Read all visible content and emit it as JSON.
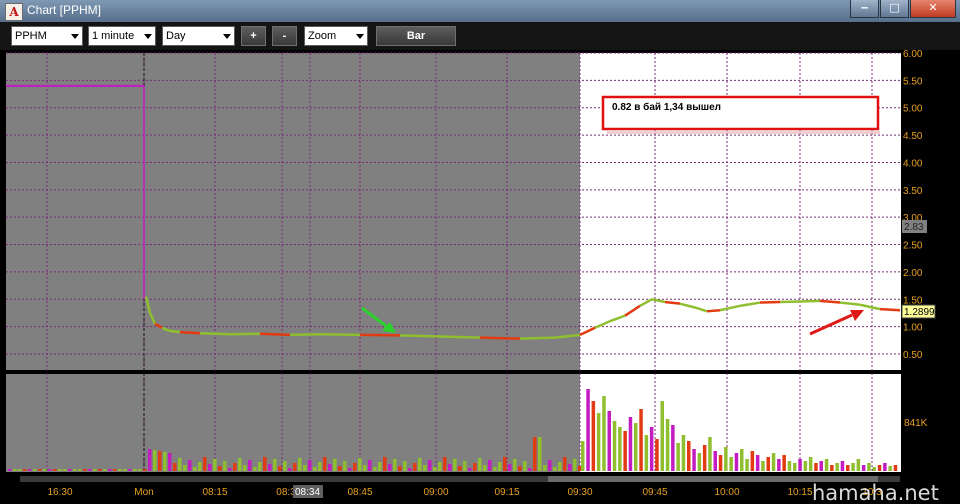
{
  "window": {
    "app_icon": "A",
    "title": "Chart [PPHM]",
    "min_glyph": "‒",
    "max_glyph": "□",
    "close_glyph": "✕"
  },
  "toolbar": {
    "symbol": "PPHM",
    "interval": "1 minute",
    "range": "Day",
    "zoom_in": "+",
    "zoom_out": "-",
    "zoom": "Zoom",
    "style": "Bar"
  },
  "annotation": {
    "text": "0.82 в бай 1,34 вышел"
  },
  "price_axis": {
    "ticks": [
      "6.00",
      "5.50",
      "5.00",
      "4.50",
      "4.00",
      "3.50",
      "3.00",
      "2.50",
      "2.00",
      "1.50",
      "1.00",
      "0.50"
    ],
    "current_price": "1.2899",
    "marker_price": "2.83"
  },
  "volume_axis": {
    "label": "841K"
  },
  "time_axis": {
    "ticks": [
      "16:30",
      "Mon",
      "08:15",
      "08:3",
      "08:45",
      "09:00",
      "09:15",
      "09:30",
      "09:45",
      "10:00",
      "10:15",
      "10:3"
    ],
    "cursor_time": "08:34"
  },
  "watermark": "hamaha.net",
  "colors": {
    "premarket_bg": "#808080",
    "session_bg": "#ffffff",
    "grid": "#7a2b7a",
    "up_bar": "#8fbf2f",
    "down_bar": "#e23a12",
    "magenta_bar": "#c21cc2",
    "arrow_green": "#2bd22b",
    "arrow_red": "#e01818",
    "annotation_border": "#e01010"
  }
}
